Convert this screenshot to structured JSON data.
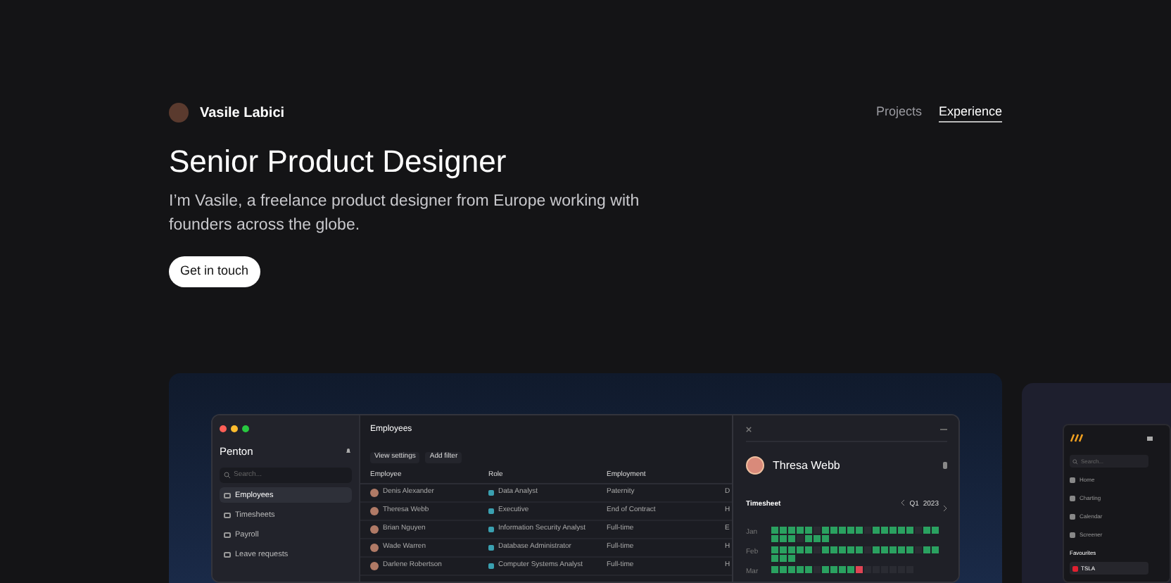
{
  "header": {
    "name": "Vasile Labici",
    "nav": [
      {
        "label": "Projects",
        "selected": false
      },
      {
        "label": "Experience",
        "selected": true
      }
    ]
  },
  "hero": {
    "title": "Senior Product Designer",
    "intro": "I’m Vasile, a freelance product designer from Europe working with founders across the globe.",
    "button": "Get in touch"
  },
  "app": {
    "workspace": "Penton",
    "search": {
      "placeholder": "Search..."
    },
    "sidebar": [
      {
        "label": "Employees",
        "selected": true
      },
      {
        "label": "Timesheets",
        "selected": false
      },
      {
        "label": "Payroll",
        "selected": false
      },
      {
        "label": "Leave requests",
        "selected": false
      }
    ],
    "page_title": "Employees",
    "toolbar": [
      "View settings",
      "Add filter"
    ],
    "columns": [
      "Employee",
      "Role",
      "Employment"
    ],
    "rows": [
      {
        "employee": "Denis Alexander",
        "role": "Data Analyst",
        "employment": "Paternity",
        "column_4": "D"
      },
      {
        "employee": "Theresa Webb",
        "role": "Executive",
        "employment": "End of Contract",
        "column_4": "H"
      },
      {
        "employee": "Brian Nguyen",
        "role": "Information Security Analyst",
        "employment": "Full-time",
        "column_4": "E"
      },
      {
        "employee": "Wade Warren",
        "role": "Database Administrator",
        "employment": "Full-time",
        "column_4": "H"
      },
      {
        "employee": "Darlene Robertson",
        "role": "Computer Systems Analyst",
        "employment": "Full-time",
        "column_4": "H"
      }
    ],
    "detail": {
      "name": "Thresa Webb",
      "section": "Timesheet",
      "quarter": "Q1",
      "year": "2023",
      "months": [
        {
          "label": "Jan",
          "days": [
            {
              "color": "#2aa160"
            },
            {
              "color": "#2aa160"
            },
            {
              "color": "#2aa160"
            },
            {
              "color": "#2aa160"
            },
            {
              "color": "#2aa160"
            },
            {
              "color": "#2a2b32"
            },
            {
              "color": "#2aa160"
            },
            {
              "color": "#2aa160"
            },
            {
              "color": "#2aa160"
            },
            {
              "color": "#2aa160"
            },
            {
              "color": "#2aa160"
            },
            {
              "color": "#2a2b32"
            },
            {
              "color": "#2aa160"
            },
            {
              "color": "#2aa160"
            },
            {
              "color": "#2aa160"
            },
            {
              "color": "#2aa160"
            },
            {
              "color": "#2aa160"
            },
            {
              "color": "#2a2b32"
            },
            {
              "color": "#2aa160"
            },
            {
              "color": "#2aa160"
            },
            {
              "color": "#2aa160"
            },
            {
              "color": "#2aa160"
            },
            {
              "color": "#2aa160"
            },
            {
              "color": "#2a2b32"
            },
            {
              "color": "#2aa160"
            },
            {
              "color": "#2aa160"
            },
            {
              "color": "#2aa160"
            }
          ]
        },
        {
          "label": "Feb",
          "days": [
            {
              "color": "#2aa160"
            },
            {
              "color": "#2aa160"
            },
            {
              "color": "#2aa160"
            },
            {
              "color": "#2aa160"
            },
            {
              "color": "#2aa160"
            },
            {
              "color": "#2a2b32"
            },
            {
              "color": "#2aa160"
            },
            {
              "color": "#2aa160"
            },
            {
              "color": "#2aa160"
            },
            {
              "color": "#2aa160"
            },
            {
              "color": "#2aa160"
            },
            {
              "color": "#2a2b32"
            },
            {
              "color": "#2aa160"
            },
            {
              "color": "#2aa160"
            },
            {
              "color": "#2aa160"
            },
            {
              "color": "#2aa160"
            },
            {
              "color": "#2aa160"
            },
            {
              "color": "#2a2b32"
            },
            {
              "color": "#2aa160"
            },
            {
              "color": "#2aa160"
            },
            {
              "color": "#2aa160"
            },
            {
              "color": "#2aa160"
            },
            {
              "color": "#2aa160"
            }
          ]
        },
        {
          "label": "Mar",
          "days": [
            {
              "color": "#2aa160"
            },
            {
              "color": "#2aa160"
            },
            {
              "color": "#2aa160"
            },
            {
              "color": "#2aa160"
            },
            {
              "color": "#2aa160"
            },
            {
              "color": "#2a2b32"
            },
            {
              "color": "#2aa160"
            },
            {
              "color": "#2aa160"
            },
            {
              "color": "#2aa160"
            },
            {
              "color": "#2aa160"
            },
            {
              "color": "#e04454"
            },
            {
              "color": "#2a2b32"
            },
            {
              "color": "#2a2b32"
            },
            {
              "color": "#2a2b32"
            },
            {
              "color": "#2a2b32"
            },
            {
              "color": "#2a2b32"
            },
            {
              "color": "#2a2b32"
            }
          ]
        }
      ]
    }
  },
  "app2": {
    "search": {
      "placeholder": "Search..."
    },
    "nav": [
      "Home",
      "Charting",
      "Calendar",
      "Screener"
    ],
    "section": "Favourites",
    "favourite": "TSLA"
  }
}
